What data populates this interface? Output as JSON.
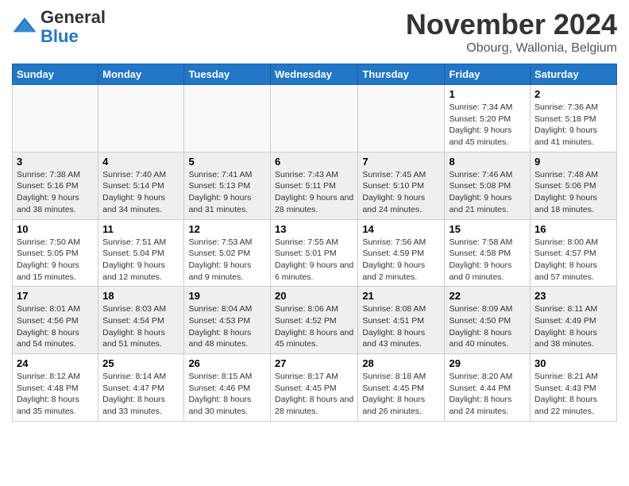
{
  "logo": {
    "general": "General",
    "blue": "Blue"
  },
  "header": {
    "title": "November 2024",
    "subtitle": "Obourg, Wallonia, Belgium"
  },
  "days_of_week": [
    "Sunday",
    "Monday",
    "Tuesday",
    "Wednesday",
    "Thursday",
    "Friday",
    "Saturday"
  ],
  "weeks": [
    [
      {
        "day": "",
        "info": ""
      },
      {
        "day": "",
        "info": ""
      },
      {
        "day": "",
        "info": ""
      },
      {
        "day": "",
        "info": ""
      },
      {
        "day": "",
        "info": ""
      },
      {
        "day": "1",
        "info": "Sunrise: 7:34 AM\nSunset: 5:20 PM\nDaylight: 9 hours and 45 minutes."
      },
      {
        "day": "2",
        "info": "Sunrise: 7:36 AM\nSunset: 5:18 PM\nDaylight: 9 hours and 41 minutes."
      }
    ],
    [
      {
        "day": "3",
        "info": "Sunrise: 7:38 AM\nSunset: 5:16 PM\nDaylight: 9 hours and 38 minutes."
      },
      {
        "day": "4",
        "info": "Sunrise: 7:40 AM\nSunset: 5:14 PM\nDaylight: 9 hours and 34 minutes."
      },
      {
        "day": "5",
        "info": "Sunrise: 7:41 AM\nSunset: 5:13 PM\nDaylight: 9 hours and 31 minutes."
      },
      {
        "day": "6",
        "info": "Sunrise: 7:43 AM\nSunset: 5:11 PM\nDaylight: 9 hours and 28 minutes."
      },
      {
        "day": "7",
        "info": "Sunrise: 7:45 AM\nSunset: 5:10 PM\nDaylight: 9 hours and 24 minutes."
      },
      {
        "day": "8",
        "info": "Sunrise: 7:46 AM\nSunset: 5:08 PM\nDaylight: 9 hours and 21 minutes."
      },
      {
        "day": "9",
        "info": "Sunrise: 7:48 AM\nSunset: 5:06 PM\nDaylight: 9 hours and 18 minutes."
      }
    ],
    [
      {
        "day": "10",
        "info": "Sunrise: 7:50 AM\nSunset: 5:05 PM\nDaylight: 9 hours and 15 minutes."
      },
      {
        "day": "11",
        "info": "Sunrise: 7:51 AM\nSunset: 5:04 PM\nDaylight: 9 hours and 12 minutes."
      },
      {
        "day": "12",
        "info": "Sunrise: 7:53 AM\nSunset: 5:02 PM\nDaylight: 9 hours and 9 minutes."
      },
      {
        "day": "13",
        "info": "Sunrise: 7:55 AM\nSunset: 5:01 PM\nDaylight: 9 hours and 6 minutes."
      },
      {
        "day": "14",
        "info": "Sunrise: 7:56 AM\nSunset: 4:59 PM\nDaylight: 9 hours and 2 minutes."
      },
      {
        "day": "15",
        "info": "Sunrise: 7:58 AM\nSunset: 4:58 PM\nDaylight: 9 hours and 0 minutes."
      },
      {
        "day": "16",
        "info": "Sunrise: 8:00 AM\nSunset: 4:57 PM\nDaylight: 8 hours and 57 minutes."
      }
    ],
    [
      {
        "day": "17",
        "info": "Sunrise: 8:01 AM\nSunset: 4:56 PM\nDaylight: 8 hours and 54 minutes."
      },
      {
        "day": "18",
        "info": "Sunrise: 8:03 AM\nSunset: 4:54 PM\nDaylight: 8 hours and 51 minutes."
      },
      {
        "day": "19",
        "info": "Sunrise: 8:04 AM\nSunset: 4:53 PM\nDaylight: 8 hours and 48 minutes."
      },
      {
        "day": "20",
        "info": "Sunrise: 8:06 AM\nSunset: 4:52 PM\nDaylight: 8 hours and 45 minutes."
      },
      {
        "day": "21",
        "info": "Sunrise: 8:08 AM\nSunset: 4:51 PM\nDaylight: 8 hours and 43 minutes."
      },
      {
        "day": "22",
        "info": "Sunrise: 8:09 AM\nSunset: 4:50 PM\nDaylight: 8 hours and 40 minutes."
      },
      {
        "day": "23",
        "info": "Sunrise: 8:11 AM\nSunset: 4:49 PM\nDaylight: 8 hours and 38 minutes."
      }
    ],
    [
      {
        "day": "24",
        "info": "Sunrise: 8:12 AM\nSunset: 4:48 PM\nDaylight: 8 hours and 35 minutes."
      },
      {
        "day": "25",
        "info": "Sunrise: 8:14 AM\nSunset: 4:47 PM\nDaylight: 8 hours and 33 minutes."
      },
      {
        "day": "26",
        "info": "Sunrise: 8:15 AM\nSunset: 4:46 PM\nDaylight: 8 hours and 30 minutes."
      },
      {
        "day": "27",
        "info": "Sunrise: 8:17 AM\nSunset: 4:45 PM\nDaylight: 8 hours and 28 minutes."
      },
      {
        "day": "28",
        "info": "Sunrise: 8:18 AM\nSunset: 4:45 PM\nDaylight: 8 hours and 26 minutes."
      },
      {
        "day": "29",
        "info": "Sunrise: 8:20 AM\nSunset: 4:44 PM\nDaylight: 8 hours and 24 minutes."
      },
      {
        "day": "30",
        "info": "Sunrise: 8:21 AM\nSunset: 4:43 PM\nDaylight: 8 hours and 22 minutes."
      }
    ]
  ]
}
